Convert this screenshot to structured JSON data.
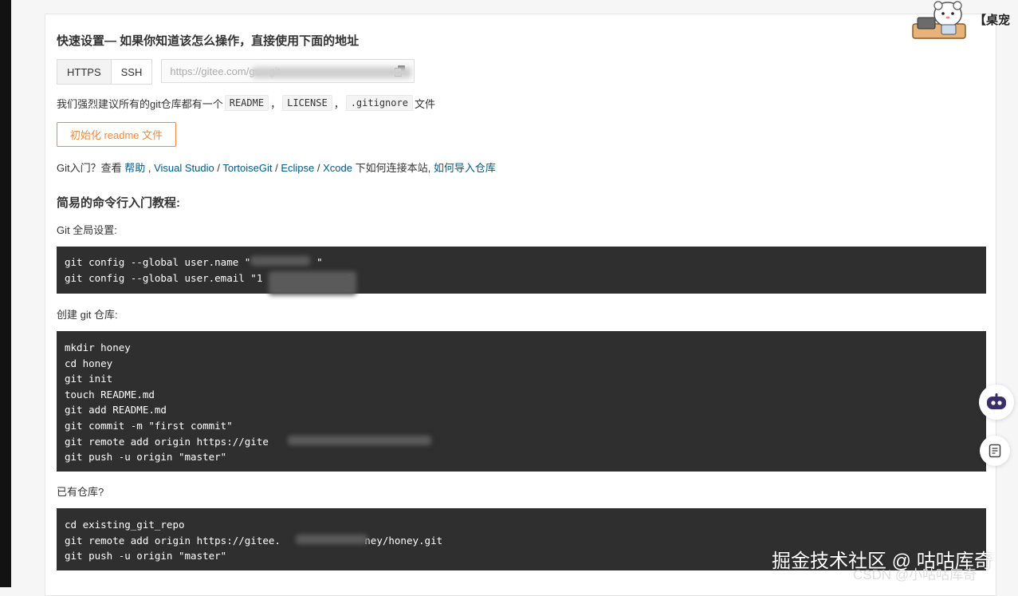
{
  "quick_setup": {
    "title": "快速设置— 如果你知道该怎么操作，直接使用下面的地址",
    "tabs": [
      {
        "label": "HTTPS",
        "active": false
      },
      {
        "label": "SSH",
        "active": true
      }
    ],
    "url_value": "https://gitee.com/gu...git"
  },
  "recommend": {
    "prefix": "我们强烈建议所有的git仓库都有一个",
    "files": [
      "README",
      "LICENSE",
      ".gitignore"
    ],
    "separator": "，",
    "suffix": "文件"
  },
  "init_button": {
    "label": "初始化 readme 文件"
  },
  "git_intro": {
    "prefix": "Git入门？查看 ",
    "help": "帮助",
    "sep1": " , ",
    "visual_studio": "Visual Studio",
    "slash": " / ",
    "tortoise": "TortoiseGit",
    "eclipse": "Eclipse",
    "xcode": "Xcode",
    "mid": " 下如何连接本站, ",
    "import": "如何导入仓库"
  },
  "tutorial": {
    "title": "简易的命令行入门教程:",
    "global_label": "Git 全局设置:",
    "global_lines": [
      "git config --global user.name \"           \"",
      "git config --global user.email \"1             m\""
    ],
    "create_label": "创建 git 仓库:",
    "create_lines": [
      "mkdir honey",
      "cd honey",
      "git init",
      "touch README.md",
      "git add README.md",
      "git commit -m \"first commit\"",
      "git remote add origin https://gite",
      "git push -u origin \"master\""
    ],
    "existing_label": "已有仓库?",
    "existing_lines": [
      "cd existing_git_repo",
      "git remote add origin https://gitee.              ney/honey.git",
      "git push -u origin \"master\""
    ]
  },
  "corner": {
    "text": "【桌宠"
  },
  "watermark": {
    "main": "掘金技术社区 @ 咕咕库奇",
    "sub": "CSDN @小咕咕库奇"
  },
  "colors": {
    "accent": "#f0883e",
    "link": "#005980",
    "code_bg": "#2f2f2f"
  }
}
